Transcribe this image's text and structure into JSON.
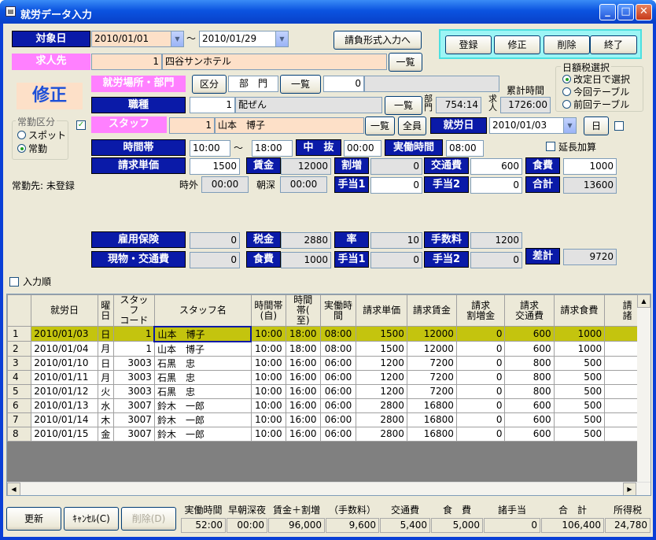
{
  "window": {
    "title": "就労データ入力",
    "icon": "app-icon"
  },
  "target_date": {
    "label": "対象日",
    "from": "2010/01/01",
    "sep": "〜",
    "to": "2010/01/29"
  },
  "request_format_button": "請負形式入力へ",
  "actions": {
    "register": "登録",
    "modify": "修正",
    "delete": "削除",
    "close": "終了"
  },
  "recruiter": {
    "label": "求人先",
    "code": "1",
    "name": "四谷サンホテル",
    "list": "一覧"
  },
  "mode_label": "修正",
  "workplace": {
    "label": "就労場所・部門",
    "kubun": "区分",
    "bumon": "部　門",
    "list": "一覧",
    "code": "0",
    "name": ""
  },
  "job": {
    "label": "職種",
    "code": "1",
    "name": "配ぜん",
    "list": "一覧"
  },
  "dept_time": {
    "label": "部門",
    "value": "754:14"
  },
  "job_time": {
    "label": "求人",
    "value": "1726:00"
  },
  "cumulative_label": "累計時間",
  "tax_select": {
    "title": "日額税選択",
    "options": [
      "改定日で選択",
      "今回テーブル",
      "前回テーブル"
    ],
    "selected": 0
  },
  "shift_type": {
    "title": "常勤区分",
    "options": [
      "スポット",
      "常勤"
    ],
    "selected": 1
  },
  "staff_check": "✓",
  "staff": {
    "label": "スタッフ",
    "code": "1",
    "name": "山本　博子",
    "list": "一覧",
    "all": "全員"
  },
  "work_day": {
    "label": "就労日",
    "value": "2010/01/03",
    "weekday": "日"
  },
  "time_band": {
    "label": "時間帯",
    "from": "10:00",
    "sep": "〜",
    "to": "18:00"
  },
  "break": {
    "label": "中　抜",
    "value": "00:00"
  },
  "actual_time": {
    "label": "実働時間",
    "value": "08:00"
  },
  "overtime_add": "延長加算",
  "billing": {
    "unit_label": "請求単価",
    "unit": "1500",
    "wage_label": "賃金",
    "wage": "12000",
    "extra_label": "割増",
    "extra": "0",
    "transport_label": "交通費",
    "transport": "600",
    "meal_label": "食費",
    "meal": "1000",
    "off_label": "時外",
    "off": "00:00",
    "night_label": "朝深",
    "night": "00:00",
    "allow1_label": "手当1",
    "allow1": "0",
    "allow2_label": "手当2",
    "allow2": "0",
    "total_label": "合計",
    "total": "13600"
  },
  "regular_status": "常勤先: 未登録",
  "payroll": {
    "insurance_label": "雇用保険",
    "insurance": "0",
    "tax_label": "税金",
    "tax": "2880",
    "rate_label": "率",
    "rate": "10",
    "fee_label": "手数料",
    "fee": "1200",
    "goods_label": "現物・交通費",
    "goods": "0",
    "meal_label": "食費",
    "meal": "1000",
    "allow1_label": "手当1",
    "allow1": "0",
    "allow2_label": "手当2",
    "allow2": "0",
    "net_label": "差計",
    "net": "9720"
  },
  "input_order": "入力順",
  "grid": {
    "columns": [
      "",
      "就労日",
      "曜日",
      "スタッフコード",
      "スタッフ名",
      "時間帯(自)",
      "時間帯(至)",
      "実働時間",
      "請求単価",
      "請求賃金",
      "請求割増金",
      "請求交通費",
      "請求食費",
      "請求諸"
    ],
    "col_heads": [
      [
        "",
        ""
      ],
      [
        "就労日"
      ],
      [
        "曜",
        "日"
      ],
      [
        "スタッフ",
        "コード"
      ],
      [
        "スタッフ名"
      ],
      [
        "時間帯",
        "(自)"
      ],
      [
        "時間",
        "帯(",
        "至)"
      ],
      [
        "実働時",
        "間"
      ],
      [
        "請求単価"
      ],
      [
        "請求賃金"
      ],
      [
        "請求",
        "割増金"
      ],
      [
        "請求",
        "交通費"
      ],
      [
        "請求食費"
      ],
      [
        "請",
        "諸"
      ]
    ],
    "rows": [
      [
        "1",
        "2010/01/03",
        "日",
        "1",
        "山本　博子",
        "10:00",
        "18:00",
        "08:00",
        "1500",
        "12000",
        "0",
        "600",
        "1000",
        ""
      ],
      [
        "2",
        "2010/01/04",
        "月",
        "1",
        "山本　博子",
        "10:00",
        "18:00",
        "08:00",
        "1500",
        "12000",
        "0",
        "600",
        "1000",
        ""
      ],
      [
        "3",
        "2010/01/10",
        "日",
        "3003",
        "石黒　忠",
        "10:00",
        "16:00",
        "06:00",
        "1200",
        "7200",
        "0",
        "800",
        "500",
        ""
      ],
      [
        "4",
        "2010/01/11",
        "月",
        "3003",
        "石黒　忠",
        "10:00",
        "16:00",
        "06:00",
        "1200",
        "7200",
        "0",
        "800",
        "500",
        ""
      ],
      [
        "5",
        "2010/01/12",
        "火",
        "3003",
        "石黒　忠",
        "10:00",
        "16:00",
        "06:00",
        "1200",
        "7200",
        "0",
        "800",
        "500",
        ""
      ],
      [
        "6",
        "2010/01/13",
        "水",
        "3007",
        "鈴木　一郎",
        "10:00",
        "16:00",
        "06:00",
        "2800",
        "16800",
        "0",
        "600",
        "500",
        ""
      ],
      [
        "7",
        "2010/01/14",
        "木",
        "3007",
        "鈴木　一郎",
        "10:00",
        "16:00",
        "06:00",
        "2800",
        "16800",
        "0",
        "600",
        "500",
        ""
      ],
      [
        "8",
        "2010/01/15",
        "金",
        "3007",
        "鈴木　一郎",
        "10:00",
        "16:00",
        "06:00",
        "2800",
        "16800",
        "0",
        "600",
        "500",
        ""
      ]
    ],
    "selected_row": 0
  },
  "footer": {
    "update": "更新",
    "cancel": "ｷｬﾝｾﾙ(C)",
    "delete": "削除(D)",
    "heads": [
      "実働時間",
      "早朝深夜",
      "賃金＋割増",
      "（手数料）",
      "交通費",
      "食　費",
      "諸手当",
      "合　計",
      "所得税"
    ],
    "values": [
      "52:00",
      "00:00",
      "96,000",
      "9,600",
      "5,400",
      "5,000",
      "0",
      "106,400",
      "24,780"
    ]
  }
}
